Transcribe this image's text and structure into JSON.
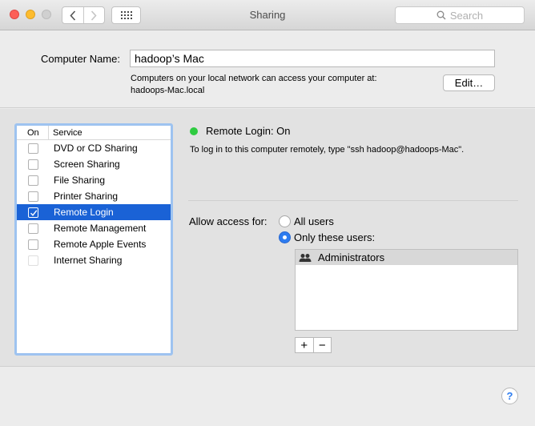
{
  "window": {
    "title": "Sharing"
  },
  "search": {
    "placeholder": "Search"
  },
  "computer_name": {
    "label": "Computer Name:",
    "value": "hadoop’s Mac",
    "description_line1": "Computers on your local network can access your computer at:",
    "description_line2": "hadoops-Mac.local",
    "edit_label": "Edit…"
  },
  "service_list": {
    "header_on": "On",
    "header_service": "Service",
    "items": [
      {
        "label": "DVD or CD Sharing",
        "checked": false,
        "selected": false,
        "disabled": false
      },
      {
        "label": "Screen Sharing",
        "checked": false,
        "selected": false,
        "disabled": false
      },
      {
        "label": "File Sharing",
        "checked": false,
        "selected": false,
        "disabled": false
      },
      {
        "label": "Printer Sharing",
        "checked": false,
        "selected": false,
        "disabled": false
      },
      {
        "label": "Remote Login",
        "checked": true,
        "selected": true,
        "disabled": false
      },
      {
        "label": "Remote Management",
        "checked": false,
        "selected": false,
        "disabled": false
      },
      {
        "label": "Remote Apple Events",
        "checked": false,
        "selected": false,
        "disabled": false
      },
      {
        "label": "Internet Sharing",
        "checked": false,
        "selected": false,
        "disabled": true
      }
    ]
  },
  "detail": {
    "status_title": "Remote Login: On",
    "status_color": "#2ecb40",
    "status_description": "To log in to this computer remotely, type \"ssh hadoop@hadoops-Mac\".",
    "access_label": "Allow access for:",
    "option_all_users": "All users",
    "option_only_users": "Only these users:",
    "selected_option": "only",
    "users": [
      {
        "name": "Administrators",
        "icon": "group-icon"
      }
    ],
    "add_label": "+",
    "remove_label": "−"
  },
  "help": {
    "label": "?"
  },
  "colors": {
    "selection": "#1a62d6",
    "accent": "#2d7cf0"
  }
}
